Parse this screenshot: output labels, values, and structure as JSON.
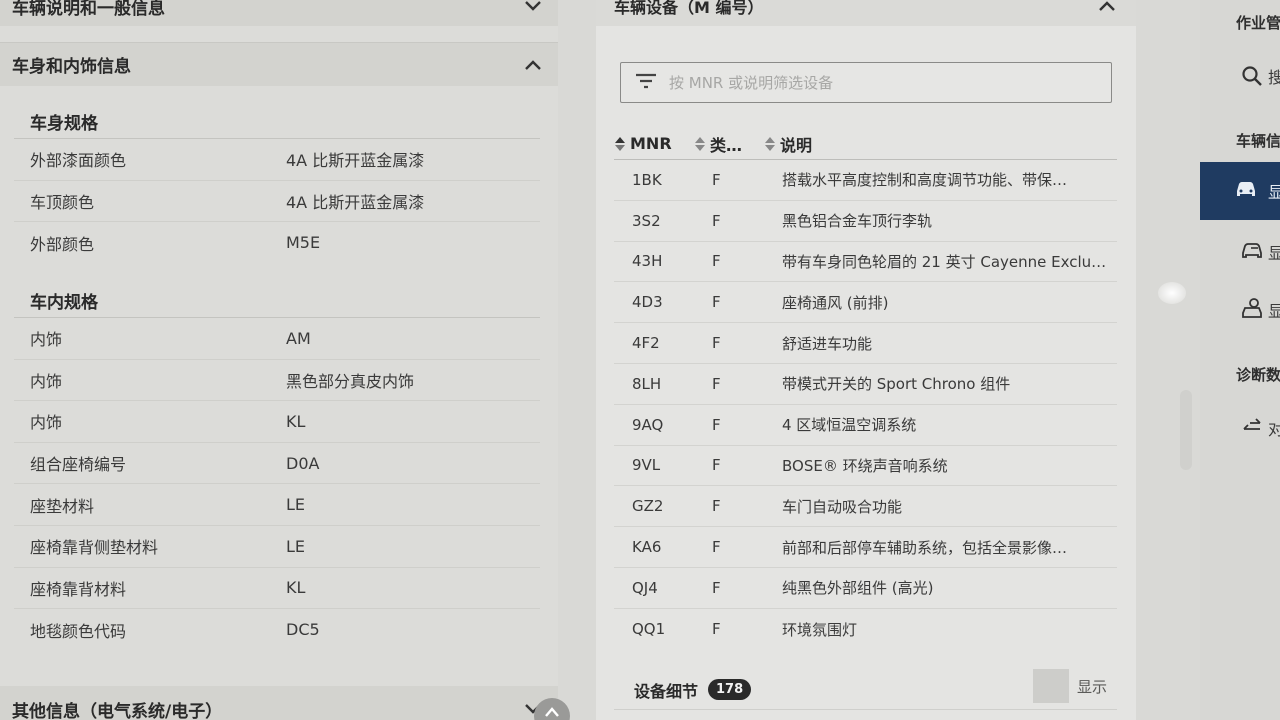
{
  "left": {
    "top_header": "车辆说明和一般信息",
    "body_header": "车身和内饰信息",
    "body_section": {
      "title": "车身规格",
      "rows": [
        {
          "key": "外部漆面颜色",
          "value": "4A 比斯开蓝金属漆"
        },
        {
          "key": "车顶颜色",
          "value": "4A 比斯开蓝金属漆"
        },
        {
          "key": "外部颜色",
          "value": "M5E"
        }
      ]
    },
    "interior_section": {
      "title": "车内规格",
      "rows": [
        {
          "key": "内饰",
          "value": "AM"
        },
        {
          "key": "内饰",
          "value": "黑色部分真皮内饰"
        },
        {
          "key": "内饰",
          "value": "KL"
        },
        {
          "key": "组合座椅编号",
          "value": "D0A"
        },
        {
          "key": "座垫材料",
          "value": "LE"
        },
        {
          "key": "座椅靠背侧垫材料",
          "value": "LE"
        },
        {
          "key": "座椅靠背材料",
          "value": "KL"
        },
        {
          "key": "地毯颜色代码",
          "value": "DC5"
        }
      ]
    },
    "bottom_header": "其他信息（电气系统/电子）"
  },
  "middle": {
    "header": "车辆设备（M 编号）",
    "filter_placeholder": "按 MNR 或说明筛选设备",
    "columns": {
      "mnr": "MNR",
      "type": "类…",
      "desc": "说明"
    },
    "rows": [
      {
        "mnr": "1BK",
        "type": "F",
        "desc": "搭载水平高度控制和高度调节功能、带保…"
      },
      {
        "mnr": "3S2",
        "type": "F",
        "desc": "黑色铝合金车顶行李轨"
      },
      {
        "mnr": "43H",
        "type": "F",
        "desc": "带有车身同色轮眉的 21 英寸 Cayenne Exclu…"
      },
      {
        "mnr": "4D3",
        "type": "F",
        "desc": "座椅通风 (前排)"
      },
      {
        "mnr": "4F2",
        "type": "F",
        "desc": "舒适进车功能"
      },
      {
        "mnr": "8LH",
        "type": "F",
        "desc": "带模式开关的 Sport Chrono 组件"
      },
      {
        "mnr": "9AQ",
        "type": "F",
        "desc": "4 区域恒温空调系统"
      },
      {
        "mnr": "9VL",
        "type": "F",
        "desc": "BOSE® 环绕声音响系统"
      },
      {
        "mnr": "GZ2",
        "type": "F",
        "desc": "车门自动吸合功能"
      },
      {
        "mnr": "KA6",
        "type": "F",
        "desc": "前部和后部停车辅助系统，包括全景影像…"
      },
      {
        "mnr": "QJ4",
        "type": "F",
        "desc": "纯黑色外部组件 (高光)"
      },
      {
        "mnr": "QQ1",
        "type": "F",
        "desc": "环境氛围灯"
      }
    ],
    "equip_detail_label": "设备细节",
    "equip_detail_count": "178",
    "show_label": "显示"
  },
  "right": {
    "work_label": "作业管",
    "vehicle_label": "车辆信",
    "diag_label": "诊断数",
    "trunc_char": "显",
    "trunc_search": "搜",
    "trunc_compare": "对"
  },
  "colors": {
    "active_nav": "#1f3b61",
    "badge_bg": "#2a2a2a"
  }
}
